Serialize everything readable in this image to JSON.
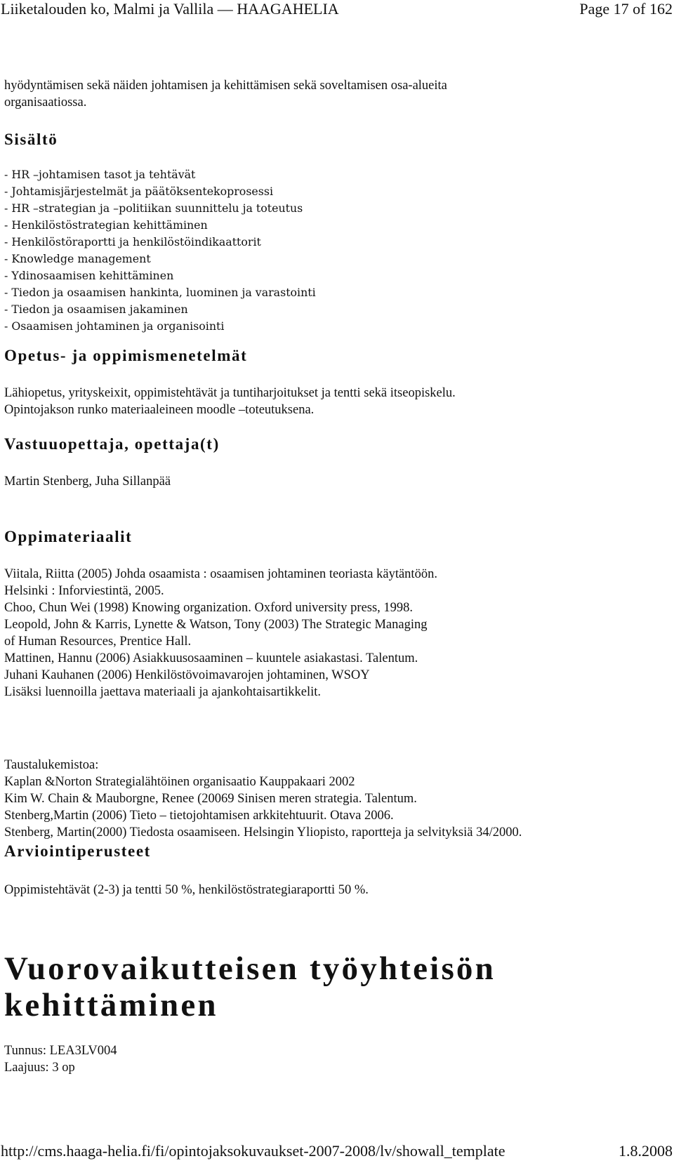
{
  "header": {
    "title": "Liiketalouden ko, Malmi ja Vallila — HAAGAHELIA",
    "page": "Page 17 of 162"
  },
  "intro": {
    "lines": [
      "hyödyntämisen sekä näiden johtamisen ja kehittämisen sekä soveltamisen osa-alueita",
      "organisaatiossa."
    ]
  },
  "sisalto": {
    "heading": "Sisältö",
    "items": [
      "- HR –johtamisen tasot ja tehtävät",
      "- Johtamisjärjestelmät ja päätöksentekoprosessi",
      "- HR –strategian ja –politiikan suunnittelu ja toteutus",
      "- Henkilöstöstrategian kehittäminen",
      "- Henkilöstöraportti ja henkilöstöindikaattorit",
      "- Knowledge management",
      "- Ydinosaamisen kehittäminen",
      "- Tiedon ja osaamisen hankinta, luominen ja varastointi",
      "- Tiedon ja osaamisen jakaminen",
      "- Osaamisen johtaminen ja organisointi"
    ]
  },
  "opetus": {
    "heading": "Opetus- ja oppimismenetelmät",
    "lines": [
      "Lähiopetus, yrityskeixit, oppimistehtävät ja tuntiharjoitukset ja tentti sekä itseopiskelu.",
      "Opintojakson runko materiaaleineen moodle –toteutuksena."
    ]
  },
  "vastuu": {
    "heading": "Vastuuopettaja, opettaja(t)",
    "text": "Martin Stenberg, Juha Sillanpää"
  },
  "oppimateriaalit": {
    "heading": "Oppimateriaalit",
    "lines": [
      "Viitala, Riitta (2005) Johda osaamista : osaamisen johtaminen teoriasta käytäntöön.",
      "Helsinki : Inforviestintä, 2005.",
      "Choo, Chun Wei (1998) Knowing organization. Oxford university press, 1998.",
      "Leopold, John & Karris, Lynette & Watson, Tony (2003) The Strategic Managing",
      "of Human Resources, Prentice Hall.",
      "Mattinen, Hannu (2006) Asiakkuusosaaminen – kuuntele asiakastasi. Talentum.",
      "Juhani Kauhanen (2006) Henkilöstövoimavarojen johtaminen, WSOY",
      "Lisäksi luennoilla jaettava materiaali ja ajankohtaisartikkelit."
    ],
    "background_label": "Taustalukemistoa:",
    "background_lines": [
      "Kaplan &Norton  Strategialähtöinen organisaatio Kauppakaari 2002",
      "Kim W. Chain & Mauborgne, Renee (20069 Sinisen meren strategia. Talentum.",
      "Stenberg,Martin (2006) Tieto – tietojohtamisen arkkitehtuurit. Otava 2006.",
      "Stenberg, Martin(2000) Tiedosta osaamiseen. Helsingin Yliopisto, raportteja ja selvityksiä 34/2000."
    ]
  },
  "arviointi": {
    "heading": "Arviointiperusteet",
    "text": "Oppimistehtävät (2-3) ja tentti 50 %, henkilöstöstrategiaraportti 50 %."
  },
  "next_course": {
    "title_line1": "Vuorovaikutteisen työyhteisön",
    "title_line2": "kehittäminen",
    "code": "Tunnus: LEA3LV004",
    "scope": "Laajuus: 3 op"
  },
  "footer": {
    "url": "http://cms.haaga-helia.fi/fi/opintojaksokuvaukset-2007-2008/lv/showall_template",
    "date": "1.8.2008"
  }
}
